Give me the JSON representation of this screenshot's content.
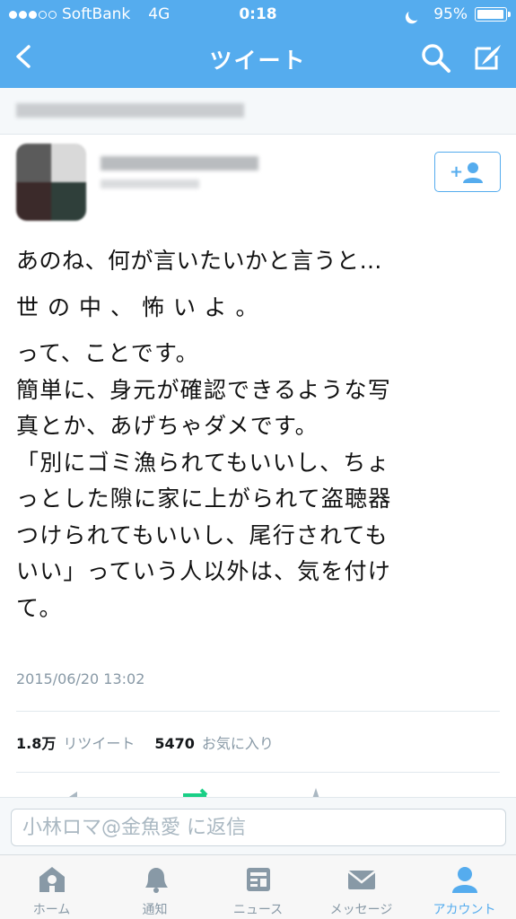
{
  "status_bar": {
    "carrier": "SoftBank",
    "network": "4G",
    "time": "0:18",
    "battery": "95%",
    "battery_level": 0.95
  },
  "nav": {
    "title": "ツイート",
    "icons": [
      "back-chevron-icon",
      "search-icon",
      "compose-icon"
    ]
  },
  "tweet": {
    "lines": [
      "あのね、何が言いたいかと言うと…",
      "世の中、怖いよ。",
      "って、ことです。",
      "簡単に、身元が確認できるような写",
      "真とか、あげちゃダメです。",
      "「別にゴミ漁られてもいいし、ちょ",
      "っとした隙に家に上がられて盗聴器",
      "つけられてもいいし、尾行されても",
      "いい」っていう人以外は、気を付け",
      "て。"
    ],
    "date": "2015/06/20 13:02",
    "retweet_count": "1.8万",
    "retweet_label": "リツイート",
    "fav_count": "5470",
    "fav_label": "お気に入り"
  },
  "reply": {
    "placeholder": "小林ロマ@金魚愛 に返信"
  },
  "tabs": [
    {
      "label": "ホーム",
      "icon": "home-icon",
      "active": false
    },
    {
      "label": "通知",
      "icon": "bell-icon",
      "active": false
    },
    {
      "label": "ニュース",
      "icon": "news-icon",
      "active": false
    },
    {
      "label": "メッセージ",
      "icon": "envelope-icon",
      "active": false
    },
    {
      "label": "アカウント",
      "icon": "person-icon",
      "active": true
    }
  ],
  "colors": {
    "brand": "#55acee",
    "text": "#14171a",
    "muted": "#8899a6"
  }
}
